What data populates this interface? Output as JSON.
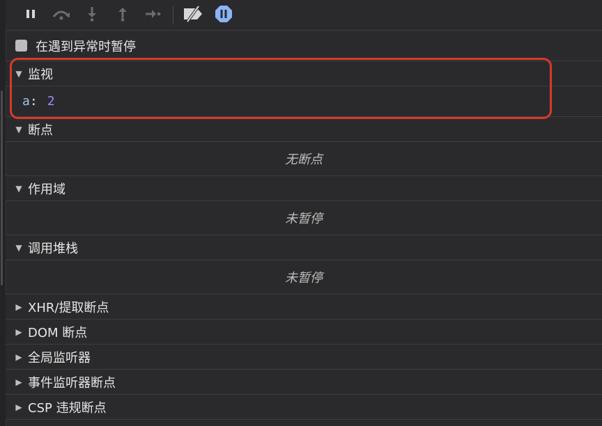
{
  "toolbar": {
    "buttons": [
      {
        "icon": "pause-icon"
      },
      {
        "icon": "step-over-icon"
      },
      {
        "icon": "step-into-icon"
      },
      {
        "icon": "step-out-icon"
      },
      {
        "icon": "step-icon"
      },
      {
        "icon": "deactivate-breakpoints-icon"
      },
      {
        "icon": "pause-on-exceptions-icon"
      }
    ],
    "accent_color": "#8ab4f8"
  },
  "pause_on_exception": {
    "label": "在遇到异常时暂停",
    "checked": false
  },
  "sections": {
    "watch": {
      "title": "监视",
      "expanded": true,
      "items": [
        {
          "name": "a",
          "colon": ":",
          "value": "2"
        }
      ]
    },
    "breakpoints": {
      "title": "断点",
      "expanded": true,
      "empty_text": "无断点"
    },
    "scope": {
      "title": "作用域",
      "expanded": true,
      "empty_text": "未暂停"
    },
    "call_stack": {
      "title": "调用堆栈",
      "expanded": true,
      "empty_text": "未暂停"
    },
    "xhr_breakpoints": {
      "title": "XHR/提取断点",
      "expanded": false
    },
    "dom_breakpoints": {
      "title": "DOM 断点",
      "expanded": false
    },
    "global_listeners": {
      "title": "全局监听器",
      "expanded": false
    },
    "event_listener_breakpoints": {
      "title": "事件监听器断点",
      "expanded": false
    },
    "csp_breakpoints": {
      "title": "CSP 违规断点",
      "expanded": false
    }
  },
  "highlight_color": "#d9392b"
}
